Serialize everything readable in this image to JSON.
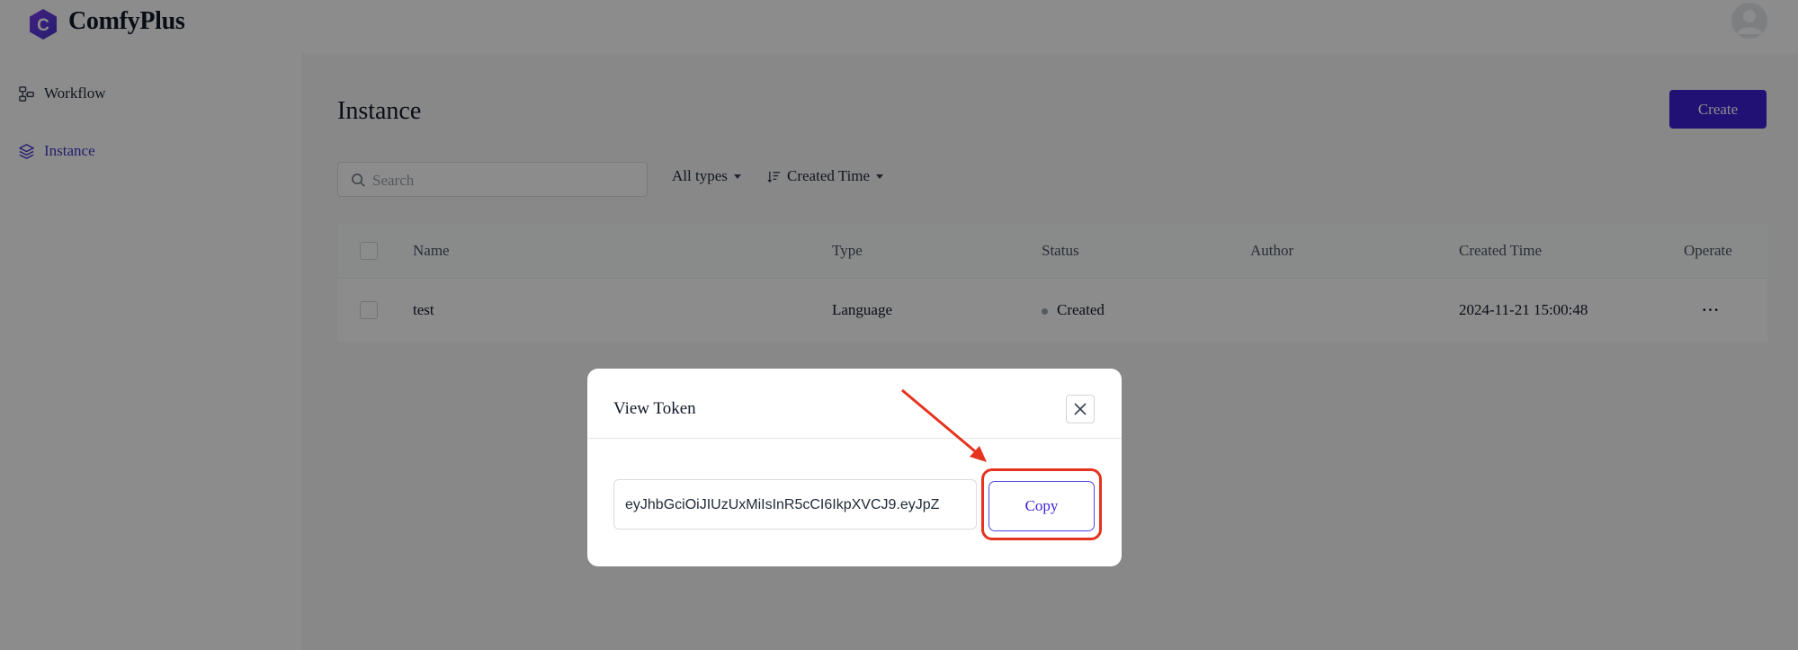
{
  "app": {
    "name": "ComfyPlus",
    "logo_letter": "C",
    "brand_color": "#3f1fd6"
  },
  "header": {
    "avatar_icon": "user-avatar-icon"
  },
  "sidebar": {
    "items": [
      {
        "label": "Workflow",
        "icon": "workflow-icon",
        "active": false
      },
      {
        "label": "Instance",
        "icon": "layers-icon",
        "active": true
      }
    ]
  },
  "main": {
    "title": "Instance",
    "create_label": "Create",
    "search": {
      "placeholder": "Search",
      "value": ""
    },
    "filters": {
      "types_label": "All types",
      "sort_label": "Created Time"
    },
    "table": {
      "columns": [
        "Name",
        "Type",
        "Status",
        "Author",
        "Created Time",
        "Operate"
      ],
      "rows": [
        {
          "name": "test",
          "type": "Language",
          "status": "Created",
          "author": "",
          "created_time": "2024-11-21 15:00:48",
          "operate": "···"
        }
      ]
    }
  },
  "modal": {
    "title": "View Token",
    "token": "eyJhbGciOiJIUzUxMiIsInR5cCI6IkpXVCJ9.eyJpZ",
    "copy_label": "Copy"
  },
  "annotation": {
    "color": "#e5331f"
  }
}
